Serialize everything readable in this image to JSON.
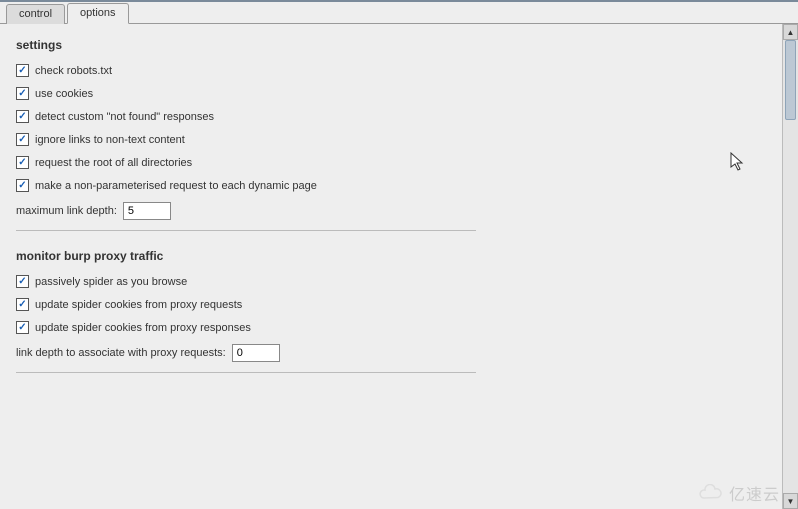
{
  "tabs": {
    "control": "control",
    "options": "options"
  },
  "settings": {
    "heading": "settings",
    "check_robots": "check robots.txt",
    "use_cookies": "use cookies",
    "detect_notfound": "detect custom \"not found\" responses",
    "ignore_nontext": "ignore links to non-text content",
    "request_root": "request the root of all directories",
    "nonparam_request": "make a non-parameterised request to each dynamic page",
    "max_link_depth_label": "maximum link depth:",
    "max_link_depth_value": "5"
  },
  "monitor": {
    "heading": "monitor burp proxy traffic",
    "passive_spider": "passively spider as you browse",
    "update_cookies_requests": "update spider cookies from proxy requests",
    "update_cookies_responses": "update spider cookies from proxy responses",
    "link_depth_assoc_label": "link depth to associate with proxy requests:",
    "link_depth_assoc_value": "0"
  },
  "watermark": "亿速云"
}
